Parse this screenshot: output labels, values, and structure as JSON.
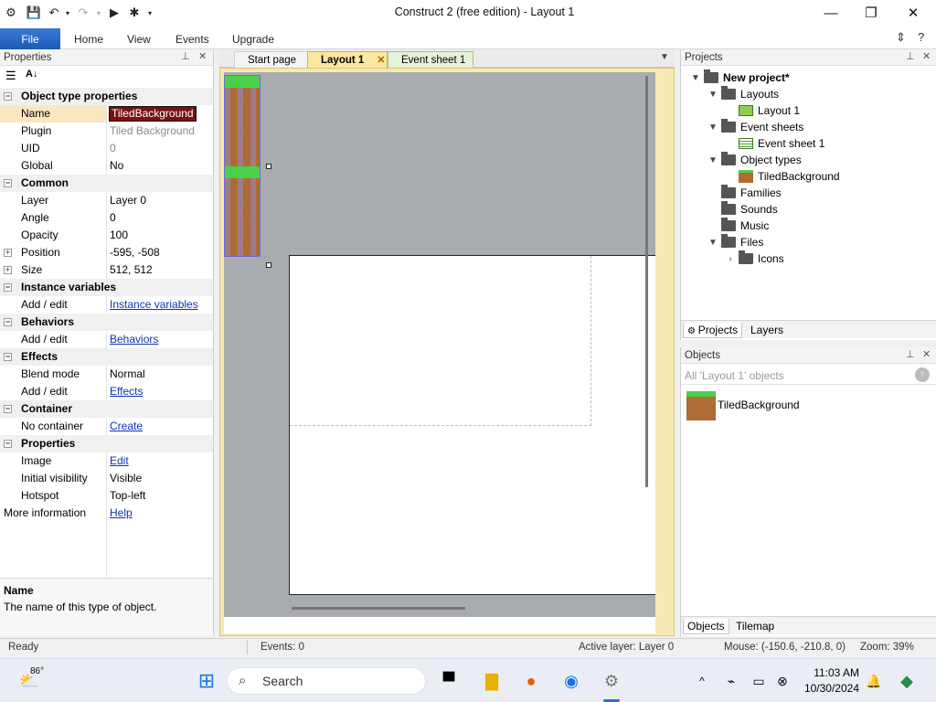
{
  "window": {
    "title": "Construct 2  (free edition) - Layout 1"
  },
  "ribbon": {
    "tabs": [
      "File",
      "Home",
      "View",
      "Events",
      "Upgrade"
    ]
  },
  "properties": {
    "title": "Properties",
    "rows": [
      {
        "type": "cat",
        "key": "Object type properties",
        "expander": "−"
      },
      {
        "type": "row",
        "key": "Name",
        "value": "TiledBackground",
        "style": "edit"
      },
      {
        "type": "row",
        "key": "Plugin",
        "value": "Tiled Background",
        "style": "gray"
      },
      {
        "type": "row",
        "key": "UID",
        "value": "0",
        "style": "gray"
      },
      {
        "type": "row",
        "key": "Global",
        "value": "No"
      },
      {
        "type": "cat",
        "key": "Common",
        "expander": "−"
      },
      {
        "type": "row",
        "key": "Layer",
        "value": "Layer 0"
      },
      {
        "type": "row",
        "key": "Angle",
        "value": "0"
      },
      {
        "type": "row",
        "key": "Opacity",
        "value": "100"
      },
      {
        "type": "row",
        "key": "Position",
        "value": "-595, -508",
        "expander": "+"
      },
      {
        "type": "row",
        "key": "Size",
        "value": "512, 512",
        "expander": "+"
      },
      {
        "type": "cat",
        "key": "Instance variables",
        "expander": "−"
      },
      {
        "type": "row",
        "key": "Add / edit",
        "value": "Instance variables",
        "style": "link"
      },
      {
        "type": "cat",
        "key": "Behaviors",
        "expander": "−"
      },
      {
        "type": "row",
        "key": "Add / edit",
        "value": "Behaviors",
        "style": "link"
      },
      {
        "type": "cat",
        "key": "Effects",
        "expander": "−"
      },
      {
        "type": "row",
        "key": "Blend mode",
        "value": "Normal"
      },
      {
        "type": "row",
        "key": "Add / edit",
        "value": "Effects",
        "style": "link"
      },
      {
        "type": "cat",
        "key": "Container",
        "expander": "−"
      },
      {
        "type": "row",
        "key": "No container",
        "value": "Create",
        "style": "link"
      },
      {
        "type": "cat",
        "key": "Properties",
        "expander": "−"
      },
      {
        "type": "row",
        "key": "Image",
        "value": "Edit",
        "style": "link"
      },
      {
        "type": "row",
        "key": "Initial visibility",
        "value": "Visible"
      },
      {
        "type": "row",
        "key": "Hotspot",
        "value": "Top-left"
      },
      {
        "type": "row",
        "key": "More information",
        "value": "Help",
        "style": "link",
        "flush": true
      }
    ],
    "help_title": "Name",
    "help_text": "The name of this type of object."
  },
  "doc_tabs": {
    "start": "Start page",
    "layout": "Layout 1",
    "events": "Event sheet 1"
  },
  "projects": {
    "title": "Projects",
    "tree": [
      {
        "label": "New project*",
        "bold": true,
        "icon": "folder-icon",
        "arrow": "▼",
        "depth": 0
      },
      {
        "label": "Layouts",
        "icon": "folder-icon",
        "arrow": "▼",
        "depth": 1
      },
      {
        "label": "Layout 1",
        "icon": "layout-icon",
        "arrow": "",
        "depth": 2
      },
      {
        "label": "Event sheets",
        "icon": "folder-icon",
        "arrow": "▼",
        "depth": 1
      },
      {
        "label": "Event sheet 1",
        "icon": "event-sheet-icon",
        "arrow": "",
        "depth": 2
      },
      {
        "label": "Object types",
        "icon": "folder-icon",
        "arrow": "▼",
        "depth": 1
      },
      {
        "label": "TiledBackground",
        "icon": "tiled-background-icon",
        "arrow": "",
        "depth": 2
      },
      {
        "label": "Families",
        "icon": "folder-icon",
        "arrow": "",
        "depth": 1
      },
      {
        "label": "Sounds",
        "icon": "folder-icon",
        "arrow": "",
        "depth": 1
      },
      {
        "label": "Music",
        "icon": "folder-icon",
        "arrow": "",
        "depth": 1
      },
      {
        "label": "Files",
        "icon": "folder-icon",
        "arrow": "▼",
        "depth": 1
      },
      {
        "label": "Icons",
        "icon": "folder-icon",
        "arrow": "›",
        "depth": 2
      }
    ],
    "tabs": [
      "Projects",
      "Layers"
    ]
  },
  "objects": {
    "title": "Objects",
    "filter": "All 'Layout 1' objects",
    "item": "TiledBackground",
    "tabs": [
      "Objects",
      "Tilemap"
    ]
  },
  "status": {
    "ready": "Ready",
    "events": "Events: 0",
    "layer": "Active layer: Layer 0",
    "mouse": "Mouse: (-150.6, -210.8, 0)",
    "zoom": "Zoom: 39%"
  },
  "taskbar": {
    "temp": "86°",
    "search": "Search",
    "time": "11:03 AM",
    "date": "10/30/2024"
  }
}
